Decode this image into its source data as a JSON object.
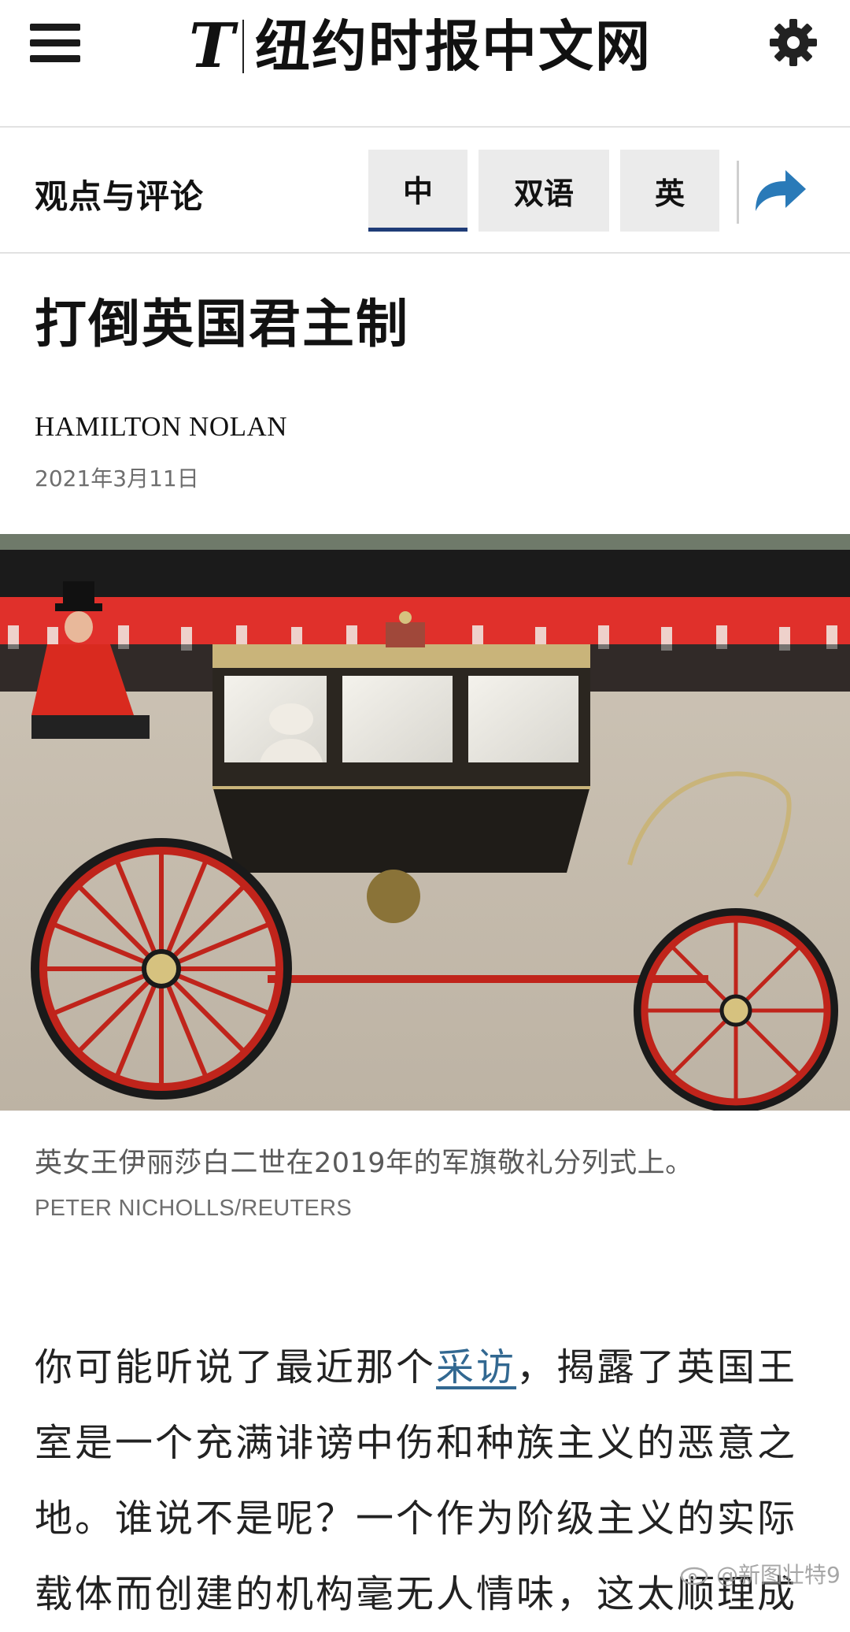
{
  "header": {
    "menu_icon": "hamburger-menu-icon",
    "logo_mark": "T",
    "logo_text": "纽约时报中文网",
    "settings_icon": "gear-icon"
  },
  "section_bar": {
    "section_title": "观点与评论",
    "tabs": [
      {
        "label": "中",
        "selected": true
      },
      {
        "label": "双语",
        "selected": false
      },
      {
        "label": "英",
        "selected": false
      }
    ],
    "share_icon": "share-arrow-icon",
    "accent_color": "#1f3c77",
    "share_color": "#2a7ab8"
  },
  "article": {
    "headline": "打倒英国君主制",
    "byline": "HAMILTON NOLAN",
    "date": "2021年3月11日",
    "photo": {
      "caption": "英女王伊丽莎白二世在2019年的军旗敬礼分列式上。",
      "credit": "PETER NICHOLLS/REUTERS"
    },
    "body": {
      "part1": "你可能听说了最近那个",
      "link": "采访",
      "part2": "，揭露了英国王室是一个充满诽谤中伤和种族主义的恶意之地。谁说不是呢？一个作为阶级主义的实际载体而创建的机构毫无人情味，这太顺理成"
    },
    "link_color": "#326891"
  },
  "watermark": {
    "text": "@新图壮特9",
    "icon": "weibo-icon"
  }
}
